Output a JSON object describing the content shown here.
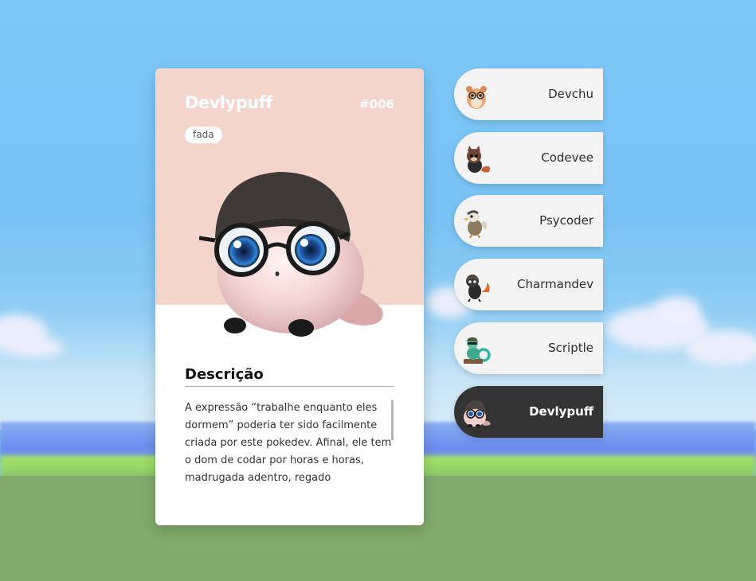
{
  "card": {
    "name": "Devlypuff",
    "number": "#006",
    "type": "fada",
    "description_title": "Descrição",
    "description_text": "A expressão “trabalhe enquanto eles dormem” poderia ter sido facilmente criada por este pokedev. Afinal, ele tem o dom de codar por horas e horas, madrugada adentro, regado",
    "theme_color": "#f3d5cc"
  },
  "list": {
    "items": [
      {
        "label": "Devchu",
        "icon": "hamster-pokedev-icon",
        "active": false
      },
      {
        "label": "Codevee",
        "icon": "fox-pokedev-icon",
        "active": false
      },
      {
        "label": "Psycoder",
        "icon": "duck-pokedev-icon",
        "active": false
      },
      {
        "label": "Charmandev",
        "icon": "lizard-pokedev-icon",
        "active": false
      },
      {
        "label": "Scriptle",
        "icon": "turtle-pokedev-icon",
        "active": false
      },
      {
        "label": "Devlypuff",
        "icon": "puffball-pokedev-icon",
        "active": true
      }
    ],
    "active_color": "#333333",
    "item_color": "#f3f3f3"
  }
}
